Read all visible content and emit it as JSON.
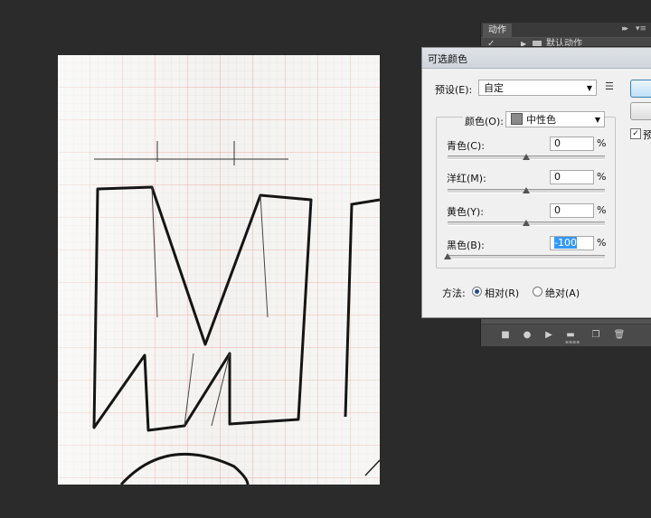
{
  "actions_panel": {
    "tab_label": "动作",
    "collapse_glyph": "▸▸",
    "menu_glyph": "▾≡",
    "row": {
      "check": "✓",
      "label": "默认动作"
    },
    "bottom_buttons": [
      "stop-icon",
      "record-icon",
      "play-icon",
      "new-set-icon",
      "new-action-icon",
      "delete-icon"
    ]
  },
  "dialog": {
    "title": "可选颜色",
    "preset": {
      "label": "预设(E):",
      "value": "自定"
    },
    "preview_label": "预",
    "colors": {
      "label": "颜色(O):",
      "value": "中性色",
      "swatch": "#8a8a8a"
    },
    "sliders": [
      {
        "label": "青色(C):",
        "value": "0",
        "position": 0.5
      },
      {
        "label": "洋红(M):",
        "value": "0",
        "position": 0.5
      },
      {
        "label": "黄色(Y):",
        "value": "0",
        "position": 0.5
      },
      {
        "label": "黑色(B):",
        "value": "-100",
        "position": 0.0,
        "selected": true
      }
    ],
    "percent": "%",
    "method": {
      "label": "方法:",
      "options": [
        {
          "label": "相对(R)",
          "selected": true
        },
        {
          "label": "绝对(A)",
          "selected": false
        }
      ]
    }
  },
  "colors": {
    "app_bg": "#2b2b2b",
    "accent": "#3399ff",
    "grid_line": "#e8b8a8"
  }
}
